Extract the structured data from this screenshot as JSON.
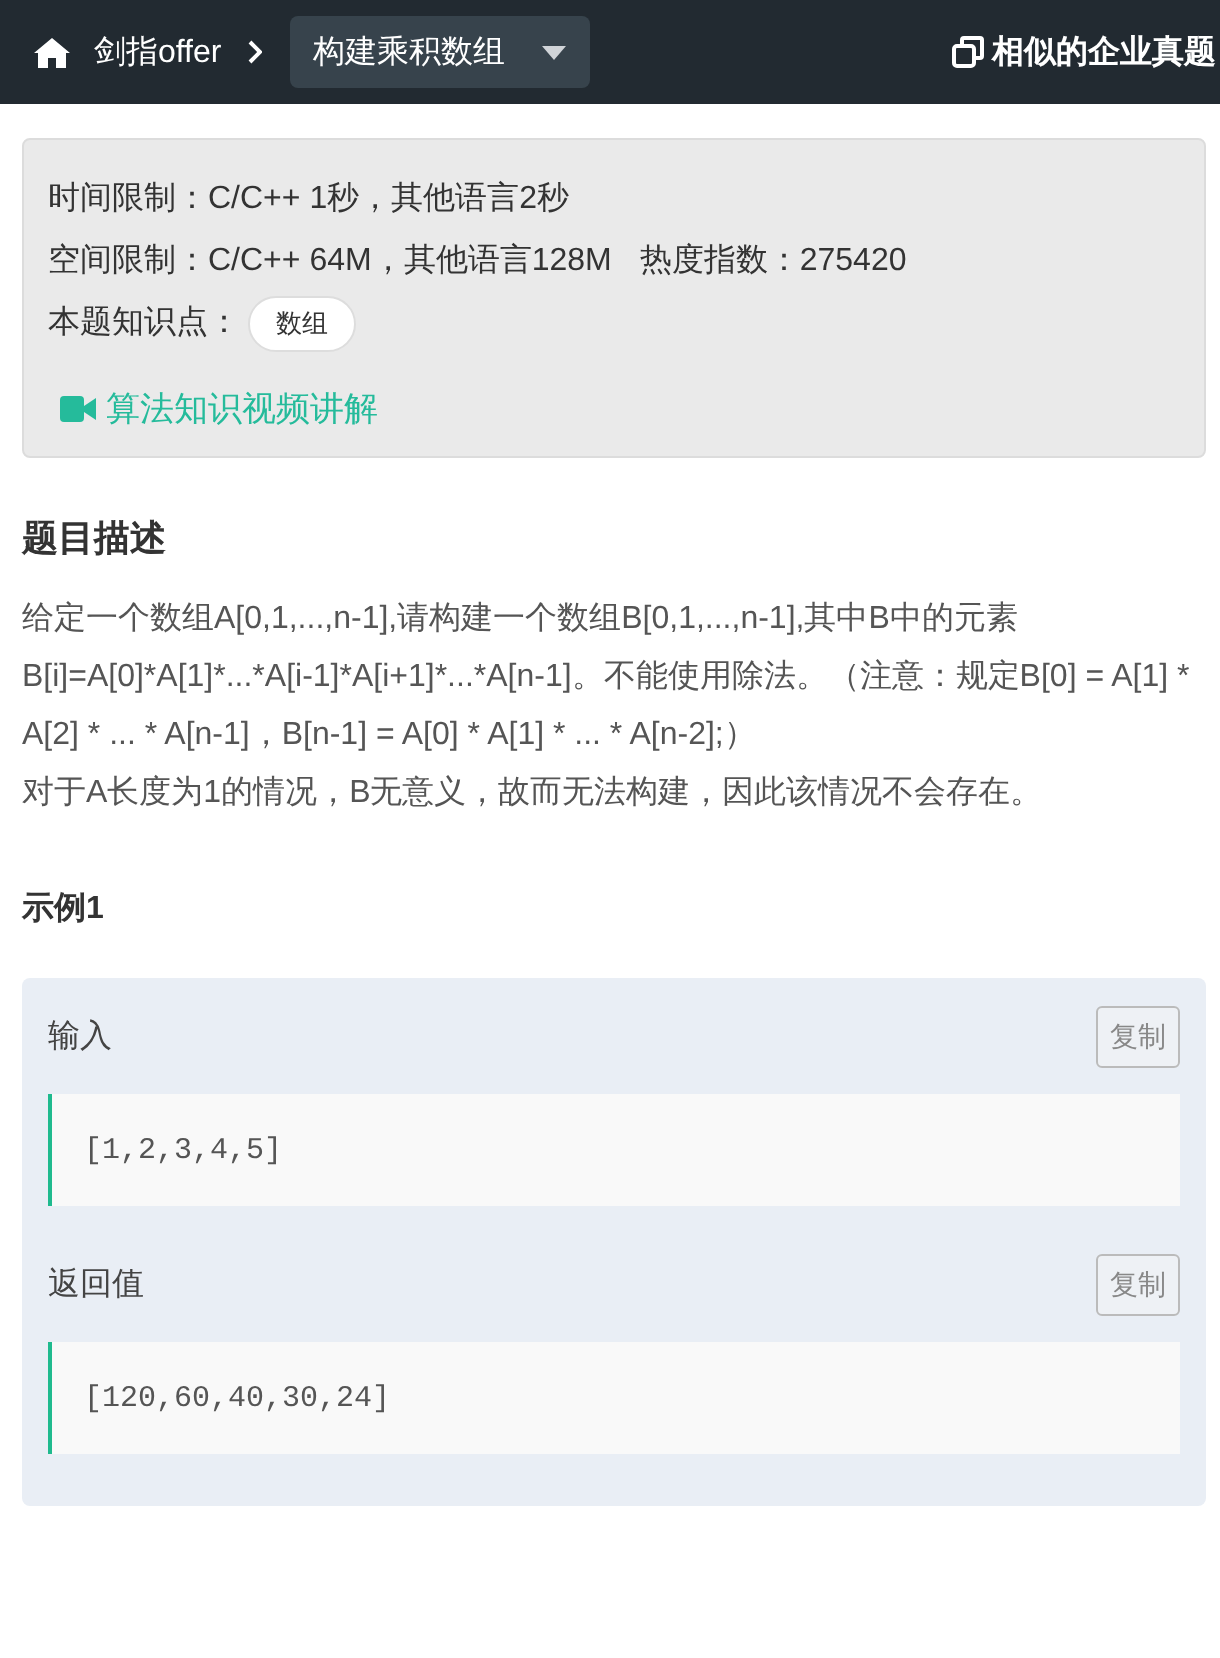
{
  "nav": {
    "home_label": "剑指offer",
    "current": "构建乘积数组",
    "similar": "相似的企业真题"
  },
  "info": {
    "time_limit": "时间限制：C/C++ 1秒，其他语言2秒",
    "space_limit": "空间限制：C/C++ 64M，其他语言128M",
    "heat": "热度指数：275420",
    "knowledge_label": "本题知识点：",
    "tags": [
      "数组"
    ],
    "video_link": "算法知识视频讲解"
  },
  "description": {
    "title": "题目描述",
    "paragraphs": [
      "给定一个数组A[0,1,...,n-1],请构建一个数组B[0,1,...,n-1],其中B中的元素B[i]=A[0]*A[1]*...*A[i-1]*A[i+1]*...*A[n-1]。不能使用除法。（注意：规定B[0] = A[1] * A[2] * ... * A[n-1]，B[n-1] = A[0] * A[1] * ... * A[n-2];）",
      "对于A长度为1的情况，B无意义，故而无法构建，因此该情况不会存在。"
    ]
  },
  "example": {
    "title": "示例1",
    "blocks": [
      {
        "label": "输入",
        "copy": "复制",
        "code": "[1,2,3,4,5]"
      },
      {
        "label": "返回值",
        "copy": "复制",
        "code": "[120,60,40,30,24]"
      }
    ]
  }
}
